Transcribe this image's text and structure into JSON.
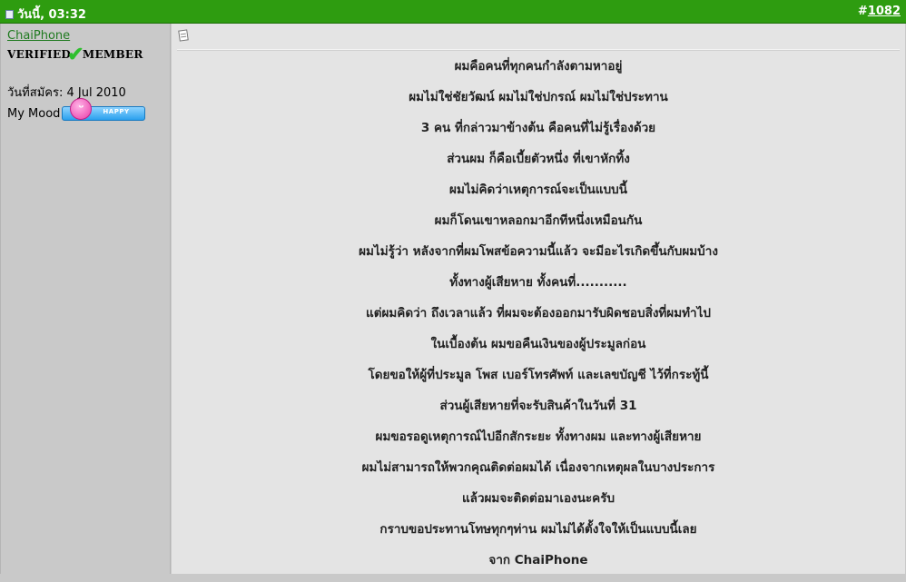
{
  "header": {
    "date_label": "วันนี้, 03:32",
    "post_number_prefix": "#",
    "post_number": "1082",
    "bar_color": "#2e9c10"
  },
  "user": {
    "username": "ChaiPhone",
    "rank_left": "VERIFIED",
    "rank_check": "✔",
    "rank_right": "MEMBER",
    "joined_label": "วันที่สมัคร:",
    "joined_date": "4 Jul 2010",
    "mood_label": "My Mood",
    "mood_value": "HAPPY"
  },
  "post": {
    "lines": [
      "ผมคือคนที่ทุกคนกำลังตามหาอยู่",
      "ผมไม่ใช่ชัยวัฒน์ ผมไม่ใช่ปกรณ์ ผมไม่ใช่ประทาน",
      "3 คน ที่กล่าวมาข้างต้น คือคนที่ไม่รู้เรื่องด้วย",
      "ส่วนผม ก็คือเบี้ยตัวหนึ่ง ที่เขาหักทิ้ง",
      "ผมไม่คิดว่าเหตุการณ์จะเป็นแบบนี้",
      "ผมก็โดนเขาหลอกมาอีกทีหนึ่งเหมือนกัน",
      "ผมไม่รู้ว่า หลังจากที่ผมโพสข้อความนี้แล้ว จะมีอะไรเกิดขึ้นกับผมบ้าง",
      "ทั้งทางผู้เสียหาย ทั้งคนที่...........",
      "แต่ผมคิดว่า ถึงเวลาแล้ว ที่ผมจะต้องออกมารับผิดชอบสิ่งที่ผมทำไป",
      "ในเบื้องต้น ผมขอคืนเงินของผู้ประมูลก่อน",
      "โดยขอให้ผู้ที่ประมูล โพส เบอร์โทรศัพท์ และเลขบัญชี ไว้ที่กระทู้นี้",
      "ส่วนผู้เสียหายที่จะรับสินค้าในวันที่ 31",
      "ผมขอรอดูเหตุการณ์ไปอีกสักระยะ ทั้งทางผม และทางผู้เสียหาย",
      "ผมไม่สามารถให้พวกคุณติดต่อผมได้ เนื่องจากเหตุผลในบางประการ",
      "แล้วผมจะติดต่อมาเองนะครับ",
      "กราบขอประทานโทษทุกๆท่าน ผมไม่ได้ตั้งใจให้เป็นแบบนี้เลย",
      "จาก ChaiPhone"
    ]
  }
}
